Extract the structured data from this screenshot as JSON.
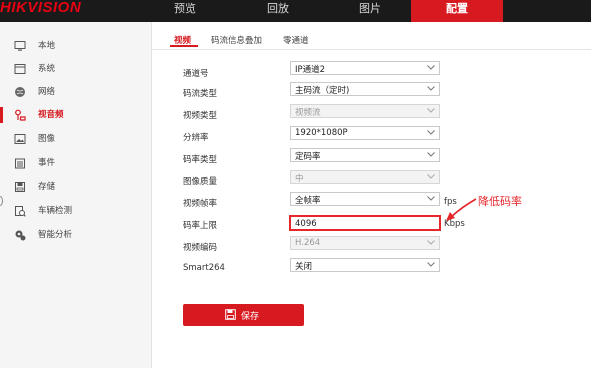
{
  "brand": {
    "logo_text": "HIKVISION"
  },
  "topnav": [
    {
      "label": "预览"
    },
    {
      "label": "回放"
    },
    {
      "label": "图片"
    },
    {
      "label": "配置",
      "active": true
    }
  ],
  "sidebar": {
    "items": [
      {
        "label": "本地",
        "icon": "monitor-icon"
      },
      {
        "label": "系统",
        "icon": "system-icon"
      },
      {
        "label": "网络",
        "icon": "network-globe-icon"
      },
      {
        "label": "视音频",
        "icon": "audio-video-icon",
        "active": true
      },
      {
        "label": "图像",
        "icon": "image-icon"
      },
      {
        "label": "事件",
        "icon": "event-calendar-icon"
      },
      {
        "label": "存储",
        "icon": "storage-icon"
      },
      {
        "label": "车辆检测",
        "icon": "vehicle-detection-icon"
      },
      {
        "label": "智能分析",
        "icon": "smart-analysis-icon"
      }
    ]
  },
  "tabs": [
    {
      "label": "视频",
      "active": true
    },
    {
      "label": "码流信息叠加"
    },
    {
      "label": "零通道"
    }
  ],
  "form": {
    "channel": {
      "label": "通道号",
      "value": "IP通道2"
    },
    "stream_type": {
      "label": "码流类型",
      "value": "主码流（定时)"
    },
    "video_type": {
      "label": "视频类型",
      "value": "视频流"
    },
    "resolution": {
      "label": "分辨率",
      "value": "1920*1080P"
    },
    "bitrate_type": {
      "label": "码率类型",
      "value": "定码率"
    },
    "image_quality": {
      "label": "图像质量",
      "value": "中"
    },
    "frame_rate": {
      "label": "视频帧率",
      "value": "全帧率",
      "unit": "fps"
    },
    "bitrate_limit": {
      "label": "码率上限",
      "value": "4096",
      "unit": "Kbps"
    },
    "video_encoding": {
      "label": "视频编码",
      "value": "H.264"
    },
    "smart264": {
      "label": "Smart264",
      "value": "关闭"
    }
  },
  "annotation": {
    "text": "降低码率",
    "color": "#e5262b"
  },
  "save_button": {
    "label": "保存"
  },
  "colors": {
    "accent": "#d71920",
    "topbar": "#1a1a1a"
  }
}
